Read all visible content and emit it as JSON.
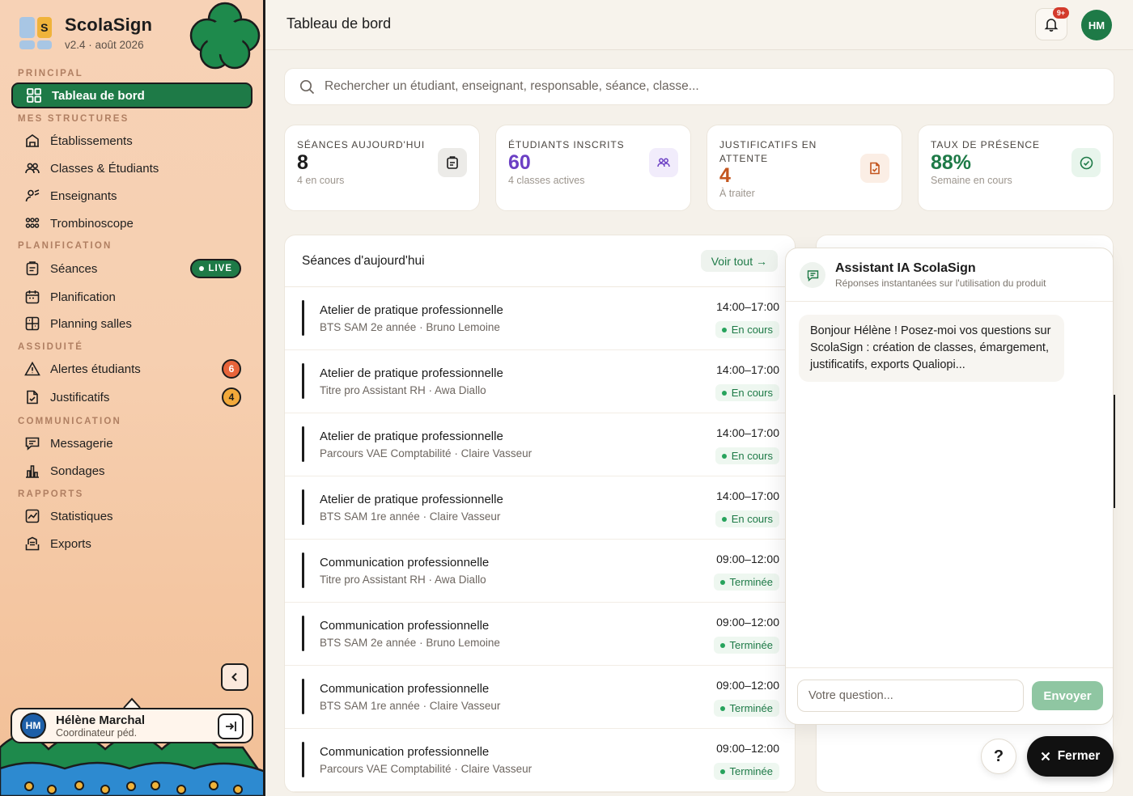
{
  "brand": {
    "name": "ScolaSign",
    "version": "v2.4 · août 2026",
    "logo_letter": "S"
  },
  "sidebar": {
    "sections": [
      {
        "title": "PRINCIPAL"
      },
      {
        "title": "MES STRUCTURES"
      },
      {
        "title": "PLANIFICATION"
      },
      {
        "title": "ASSIDUITÉ"
      },
      {
        "title": "COMMUNICATION"
      },
      {
        "title": "RAPPORTS"
      }
    ],
    "items": [
      {
        "label": "Tableau de bord",
        "icon": "dashboard-icon"
      },
      {
        "label": "Établissements",
        "icon": "building-icon"
      },
      {
        "label": "Classes & Étudiants",
        "icon": "users-icon"
      },
      {
        "label": "Enseignants",
        "icon": "teacher-icon"
      },
      {
        "label": "Trombinoscope",
        "icon": "faces-icon"
      },
      {
        "label": "Séances",
        "icon": "clipboard-icon",
        "badge": "LIVE"
      },
      {
        "label": "Planification",
        "icon": "calendar-icon"
      },
      {
        "label": "Planning salles",
        "icon": "grid-icon"
      },
      {
        "label": "Alertes étudiants",
        "icon": "warning-icon",
        "badge": "6"
      },
      {
        "label": "Justificatifs",
        "icon": "document-check-icon",
        "badge": "4"
      },
      {
        "label": "Messagerie",
        "icon": "message-icon"
      },
      {
        "label": "Sondages",
        "icon": "bar-chart-icon"
      },
      {
        "label": "Statistiques",
        "icon": "line-chart-icon"
      },
      {
        "label": "Exports",
        "icon": "export-icon"
      }
    ],
    "user": {
      "initials": "HM",
      "name": "Hélène Marchal",
      "role": "Coordinateur péd."
    }
  },
  "header": {
    "title": "Tableau de bord",
    "notif_count": "9+",
    "avatar_initials": "HM"
  },
  "search": {
    "placeholder": "Rechercher un étudiant, enseignant, responsable, séance, classe..."
  },
  "stats": [
    {
      "label": "SÉANCES AUJOURD'HUI",
      "value": "8",
      "sub": "4 en cours",
      "color": "#1c1c1c"
    },
    {
      "label": "ÉTUDIANTS INSCRITS",
      "value": "60",
      "sub": "4 classes actives",
      "color": "#6b3fc4"
    },
    {
      "label": "JUSTIFICATIFS EN ATTENTE",
      "value": "4",
      "sub": "À traiter",
      "color": "#c3551e"
    },
    {
      "label": "TAUX DE PRÉSENCE",
      "value": "88%",
      "sub": "Semaine en cours",
      "color": "#1e7a47"
    }
  ],
  "sessions": {
    "title": "Séances d'aujourd'hui",
    "see_all": "Voir tout →",
    "rows": [
      {
        "name": "Atelier de pratique professionnelle",
        "meta": "BTS SAM 2e année · Bruno Lemoine",
        "time": "14:00–17:00",
        "status": "En cours"
      },
      {
        "name": "Atelier de pratique professionnelle",
        "meta": "Titre pro Assistant RH · Awa Diallo",
        "time": "14:00–17:00",
        "status": "En cours"
      },
      {
        "name": "Atelier de pratique professionnelle",
        "meta": "Parcours VAE Comptabilité · Claire Vasseur",
        "time": "14:00–17:00",
        "status": "En cours"
      },
      {
        "name": "Atelier de pratique professionnelle",
        "meta": "BTS SAM 1re année · Claire Vasseur",
        "time": "14:00–17:00",
        "status": "En cours"
      },
      {
        "name": "Communication professionnelle",
        "meta": "Titre pro Assistant RH · Awa Diallo",
        "time": "09:00–12:00",
        "status": "Terminée"
      },
      {
        "name": "Communication professionnelle",
        "meta": "BTS SAM 2e année · Bruno Lemoine",
        "time": "09:00–12:00",
        "status": "Terminée"
      },
      {
        "name": "Communication professionnelle",
        "meta": "BTS SAM 1re année · Claire Vasseur",
        "time": "09:00–12:00",
        "status": "Terminée"
      },
      {
        "name": "Communication professionnelle",
        "meta": "Parcours VAE Comptabilité · Claire Vasseur",
        "time": "09:00–12:00",
        "status": "Terminée"
      }
    ]
  },
  "assistant": {
    "title": "Assistant IA ScolaSign",
    "subtitle": "Réponses instantanées sur l'utilisation du produit",
    "message": "Bonjour Hélène ! Posez-moi vos questions sur ScolaSign : création de classes, émargement, justificatifs, exports Qualiopi...",
    "input_placeholder": "Votre question...",
    "send_label": "Envoyer"
  },
  "help_label": "?",
  "close_label": "Fermer",
  "colors": {
    "brand_green": "#1e7a47",
    "accent_orange": "#e8923a",
    "alert_red": "#d33a2c"
  }
}
